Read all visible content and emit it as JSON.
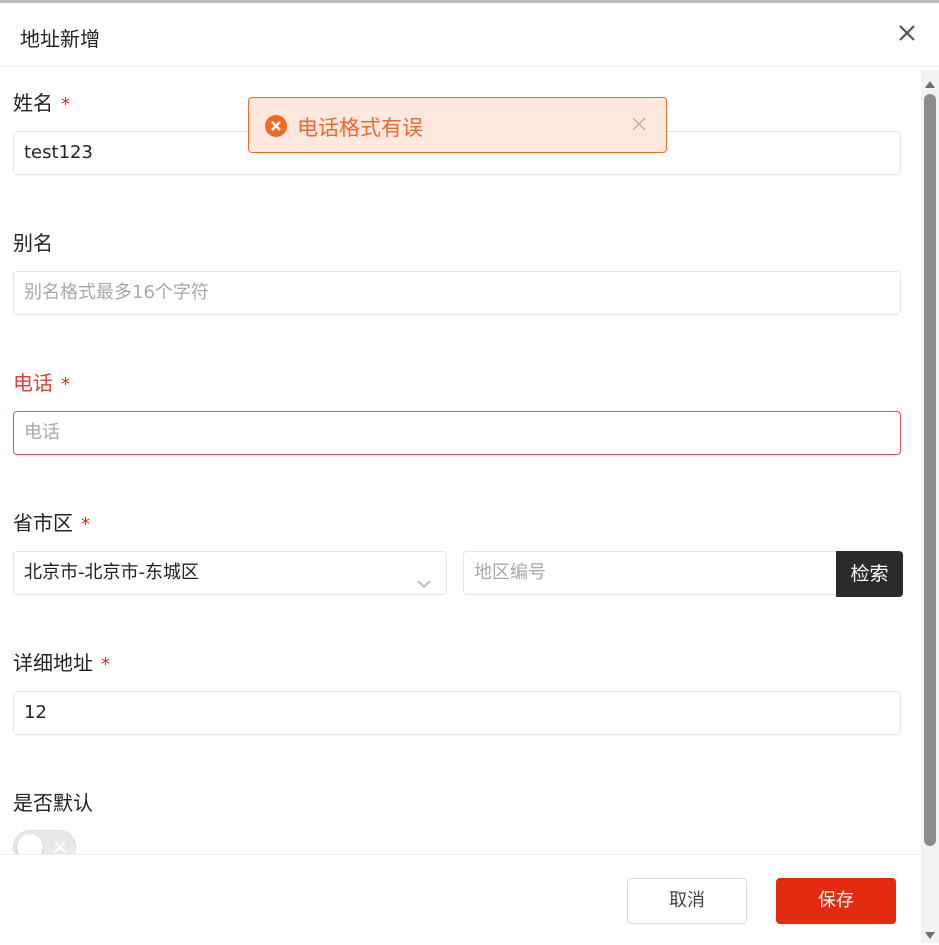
{
  "dialog": {
    "title": "地址新增"
  },
  "form": {
    "name": {
      "label": "姓名",
      "required_mark": "*",
      "value": "test123"
    },
    "alias": {
      "label": "别名",
      "placeholder": "别名格式最多16个字符"
    },
    "phone": {
      "label": "电话",
      "required_mark": "*",
      "placeholder": "电话"
    },
    "region": {
      "label": "省市区",
      "required_mark": "*",
      "selected": "北京市-北京市-东城区",
      "code_placeholder": "地区编号",
      "search_label": "检索"
    },
    "address": {
      "label": "详细地址",
      "required_mark": "*",
      "value": "12"
    },
    "default": {
      "label": "是否默认",
      "on": false
    }
  },
  "toast": {
    "type": "error",
    "message": "电话格式有误"
  },
  "footer": {
    "cancel_label": "取消",
    "save_label": "保存"
  },
  "colors": {
    "accent": "#e3290e",
    "error_text": "#d9433a",
    "toast_bg": "#fde8df",
    "toast_border": "#e86a24",
    "dark_button": "#2b2b2b"
  }
}
